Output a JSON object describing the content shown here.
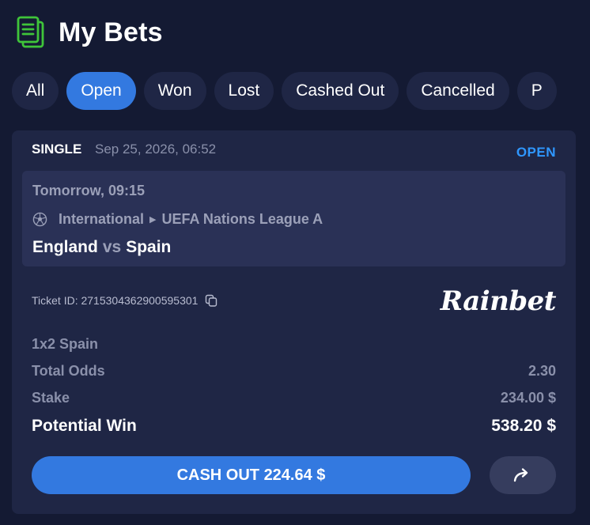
{
  "header": {
    "title": "My Bets",
    "icon": "bets-icon"
  },
  "tabs": [
    {
      "label": "All"
    },
    {
      "label": "Open"
    },
    {
      "label": "Won"
    },
    {
      "label": "Lost"
    },
    {
      "label": "Cashed Out"
    },
    {
      "label": "Cancelled"
    },
    {
      "label": "P"
    }
  ],
  "colors": {
    "accent": "#3379e0",
    "status": "#2f97ff",
    "background": "#141a33",
    "card": "#1f2645",
    "icon": "#3fc43a"
  },
  "bet": {
    "type": "SINGLE",
    "date": "Sep 25, 2026, 06:52",
    "status": "OPEN",
    "event": {
      "time": "Tomorrow, 09:15",
      "category": "International",
      "league": "UEFA Nations League A",
      "home": "England",
      "vs": "vs",
      "away": "Spain"
    },
    "ticket_label": "Ticket ID: 2715304362900595301",
    "brand": "Rainbet",
    "selection": "1x2 Spain",
    "total_odds_label": "Total Odds",
    "total_odds": "2.30",
    "stake_label": "Stake",
    "stake": "234.00 $",
    "potential_win_label": "Potential Win",
    "potential_win": "538.20 $",
    "cashout_label": "CASH OUT 224.64 $"
  }
}
